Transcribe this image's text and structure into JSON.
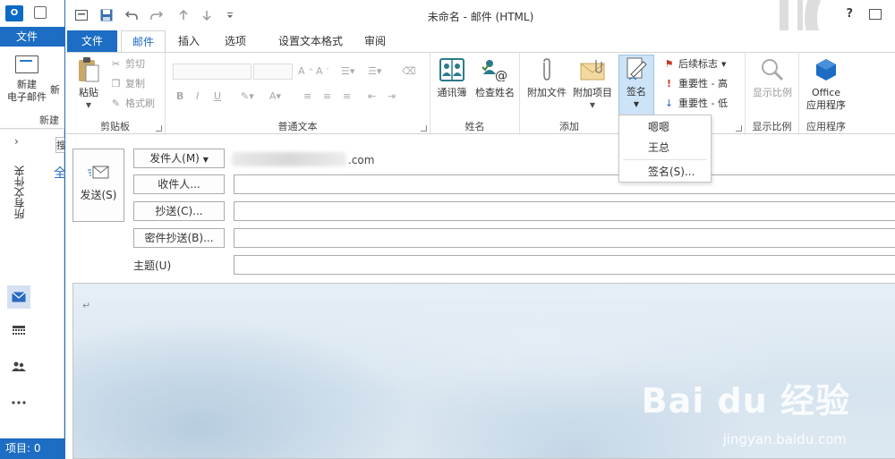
{
  "background_app": {
    "logo_text": "O",
    "file_tab": "文件",
    "new_mail_label": "新建\n电子邮件",
    "new_partial": "新",
    "new_group": "新建",
    "expand": "›",
    "folder_vertical": "所有文件夹",
    "search_partial": "搜",
    "all_partial": "全",
    "status": "项目: 0"
  },
  "window": {
    "title": "未命名 - 邮件 (HTML)",
    "help": "?"
  },
  "tabs": [
    {
      "label": "文件"
    },
    {
      "label": "邮件"
    },
    {
      "label": "插入"
    },
    {
      "label": "选项"
    },
    {
      "label": "设置文本格式"
    },
    {
      "label": "审阅"
    }
  ],
  "ribbon": {
    "clipboard": {
      "paste": "粘贴",
      "cut": "剪切",
      "copy": "复制",
      "format_painter": "格式刷",
      "group": "剪贴板"
    },
    "basic_text": {
      "group": "普通文本"
    },
    "names": {
      "address_book": "通讯簿",
      "check_names": "检查姓名",
      "group": "姓名"
    },
    "include": {
      "attach_file": "附加文件",
      "attach_item": "附加项目",
      "signature": "签名",
      "group": "添加"
    },
    "tags": {
      "follow_up": "后续标志",
      "high_importance": "重要性 - 高",
      "low_importance": "重要性 - 低"
    },
    "zoom": {
      "zoom": "显示比例",
      "group": "显示比例"
    },
    "apps": {
      "office_apps_line1": "Office",
      "office_apps_line2": "应用程序",
      "group": "应用程序"
    }
  },
  "signature_menu": {
    "items": [
      "嗯嗯",
      "王总"
    ],
    "signatures": "签名(S)..."
  },
  "message": {
    "send": "发送(S)",
    "from": "发件人(M)",
    "from_value": ".com",
    "to": "收件人...",
    "cc": "抄送(C)...",
    "bcc": "密件抄送(B)...",
    "subject": "主题(U)",
    "paragraph_mark": "↵"
  },
  "watermark": {
    "logo": "Bai du 经验",
    "url": "jingyan.baidu.com"
  },
  "colors": {
    "accent": "#1c6dc3",
    "signature_hover": "#cde3f7"
  }
}
